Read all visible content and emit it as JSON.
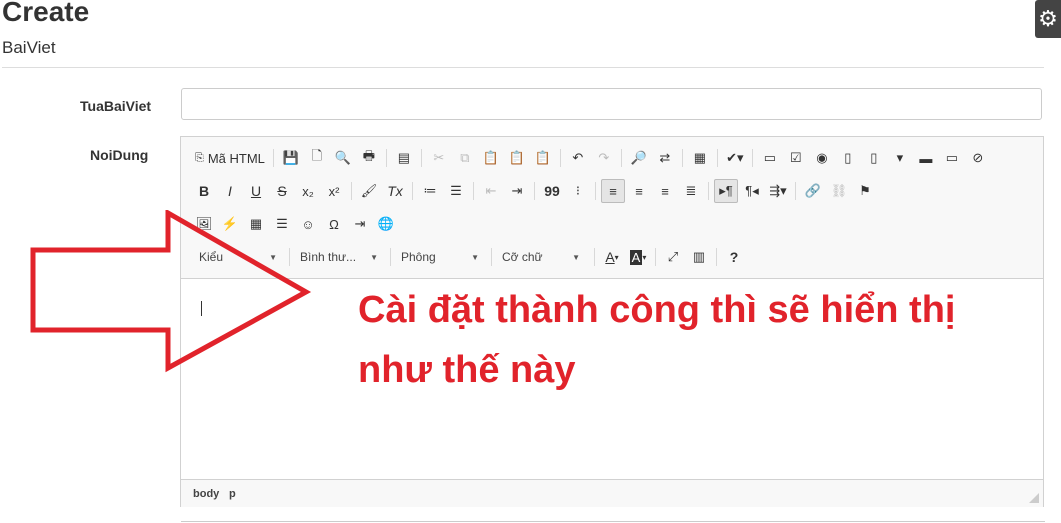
{
  "page": {
    "title": "Create",
    "subtitle": "BaiViet"
  },
  "form": {
    "title_label": "TuaBaiViet",
    "title_value": "",
    "content_label": "NoiDung"
  },
  "editor": {
    "source_label": "Mã HTML",
    "combos": {
      "style": "Kiểu",
      "format": "Bình thư...",
      "font": "Phông",
      "size": "Cỡ chữ"
    },
    "toolbar_glyphs": {
      "bold": "B",
      "italic": "I",
      "underline": "U",
      "strike": "S",
      "subscript": "x₂",
      "superscript": "x²",
      "removeformat": "Tx",
      "blockquote": "99",
      "text_color": "A",
      "bg_color": "A",
      "help": "?"
    },
    "status_path": [
      "body",
      "p"
    ]
  },
  "annotation": {
    "text": "Cài đặt thành công thì sẽ hiển thị như thế này",
    "color": "#e1232b"
  },
  "colors": {
    "accent": "#e1232b",
    "toolbar_bg": "#f8f8f8",
    "border": "#d1d1d1"
  }
}
